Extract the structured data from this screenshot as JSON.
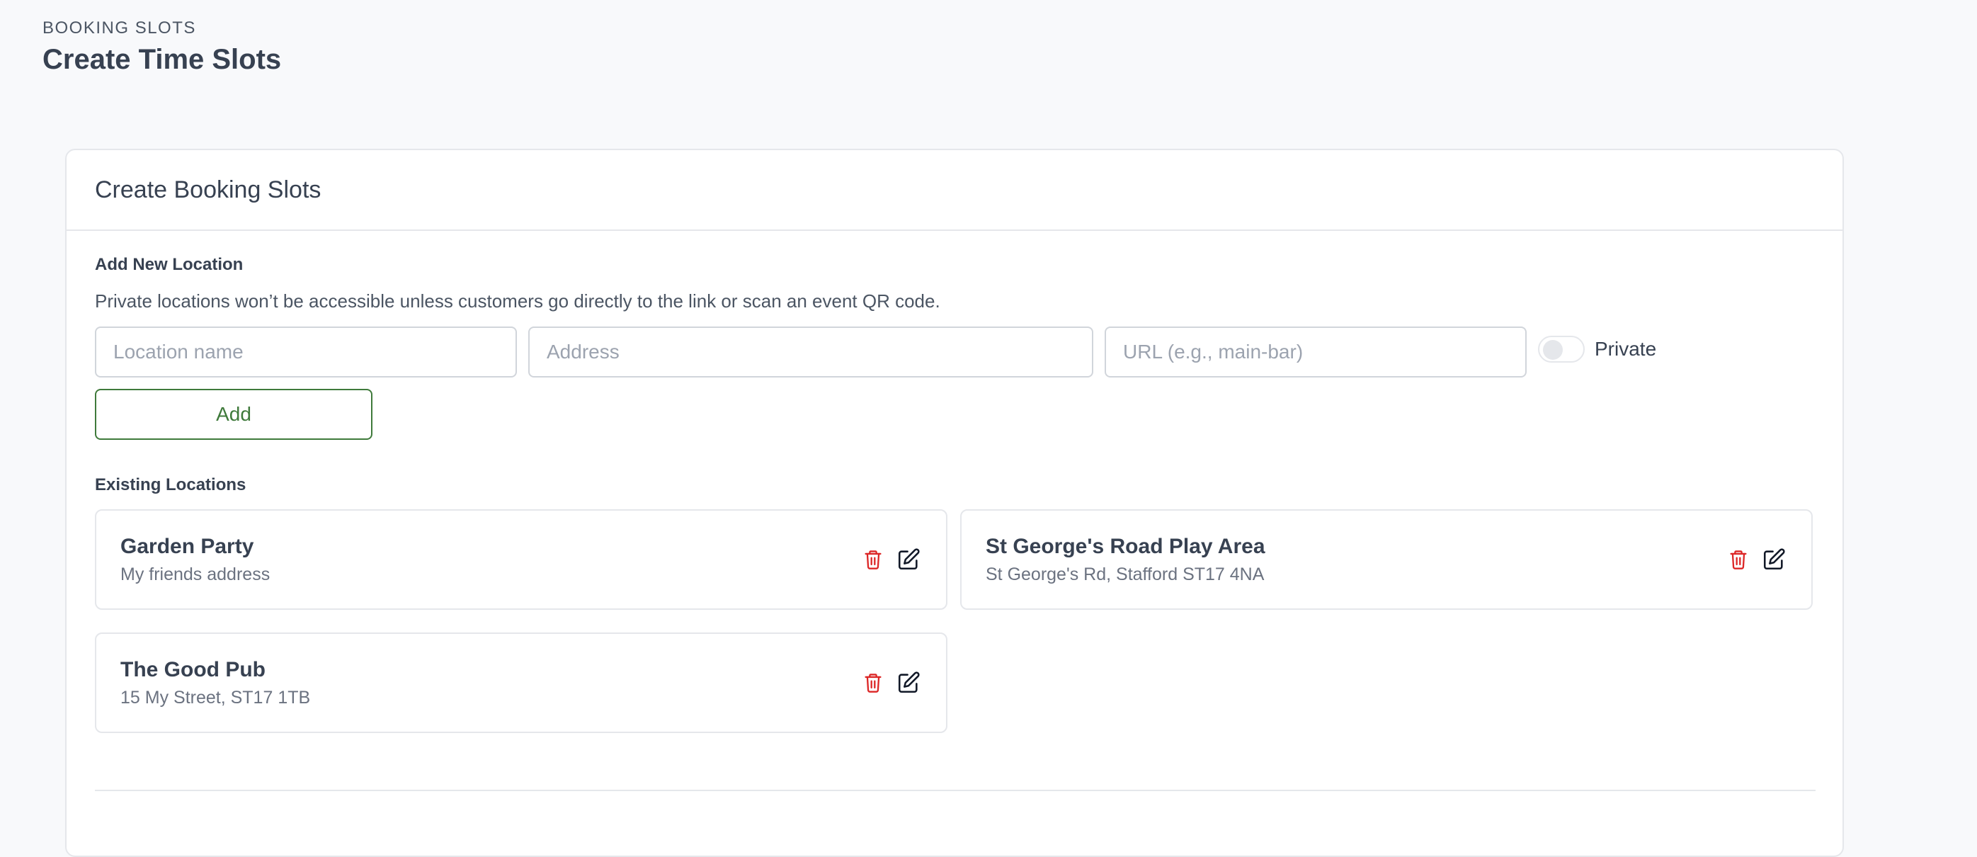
{
  "header": {
    "eyebrow": "BOOKING SLOTS",
    "title": "Create Time Slots"
  },
  "card": {
    "title": "Create Booking Slots"
  },
  "add_location": {
    "label": "Add New Location",
    "help": "Private locations won’t be accessible unless customers go directly to the link or scan an event QR code.",
    "name_placeholder": "Location name",
    "address_placeholder": "Address",
    "url_placeholder": "URL (e.g., main-bar)",
    "private_label": "Private",
    "private_on": false,
    "add_label": "Add"
  },
  "existing": {
    "label": "Existing Locations",
    "locations": [
      {
        "name": "Garden Party",
        "address": "My friends address"
      },
      {
        "name": "St George's Road Play Area",
        "address": "St George's Rd, Stafford ST17 4NA"
      },
      {
        "name": "The Good Pub",
        "address": "15 My Street, ST17 1TB"
      }
    ]
  },
  "icons": {
    "delete": "trash-icon",
    "edit": "pencil-edit-icon"
  },
  "colors": {
    "accent": "#3f7a3b",
    "danger": "#dc2626",
    "border": "#e5e7eb"
  }
}
